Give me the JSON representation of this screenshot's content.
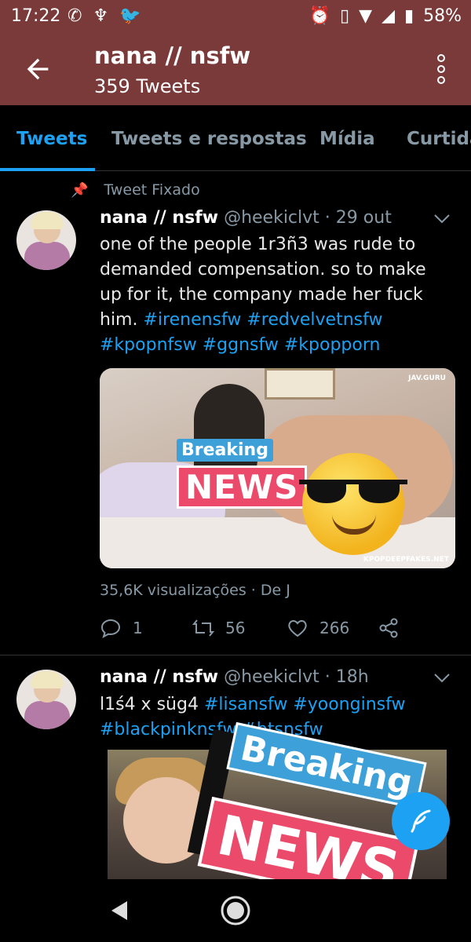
{
  "status_bar": {
    "time": "17:22",
    "battery": "58%"
  },
  "header": {
    "title": "nana // nsfw",
    "subtitle": "359 Tweets"
  },
  "tabs": [
    {
      "label": "Tweets",
      "active": true
    },
    {
      "label": "Tweets e respostas",
      "active": false
    },
    {
      "label": "Mídia",
      "active": false
    },
    {
      "label": "Curtidas",
      "active": false
    }
  ],
  "pinned_label": "Tweet Fixado",
  "tweets": [
    {
      "name": "nana // nsfw",
      "handle": "@heekiclvt",
      "sep": "·",
      "time": "29 out",
      "text_plain": "one of the people 1r3ñ3 was rude to demanded compensation. so to make up for it, the company made her fuck him.",
      "hashtags": [
        "#irenensfw",
        "#redvelvetnsfw",
        "#kpopnfsw",
        "#ggnsfw",
        "#kpopporn"
      ],
      "media_overlay": {
        "breaking": "Breaking",
        "news": "NEWS",
        "watermark_top": "JAV.GURU",
        "watermark_bottom": "KPOPDEEPFAKES.NET"
      },
      "views": "35,6K visualizações",
      "views_sep": "·",
      "views_source": "De J",
      "replies": "1",
      "retweets": "56",
      "likes": "266"
    },
    {
      "name": "nana // nsfw",
      "handle": "@heekiclvt",
      "sep": "·",
      "time": "18h",
      "text_plain": "l1ś4 x süg4",
      "hashtags": [
        "#lisansfw",
        "#yoonginsfw",
        "#blackpinknsfw",
        "#btsnsfw"
      ],
      "media_overlay": {
        "breaking": "Breaking",
        "news": "NEWS"
      }
    }
  ],
  "colors": {
    "header_bg": "#7a3a3a",
    "accent": "#1da1f2",
    "muted": "#8899a6",
    "breaking_blue": "#3da0d8",
    "news_pink": "#ec4a6a"
  }
}
